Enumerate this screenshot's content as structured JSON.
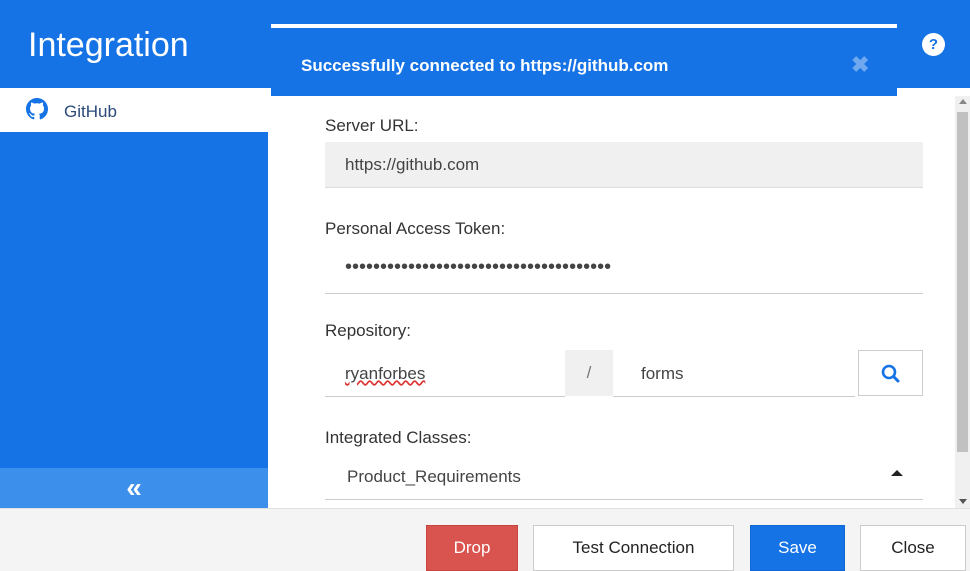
{
  "header": {
    "title": "Integration",
    "help_icon": "help-icon"
  },
  "sidebar": {
    "items": [
      {
        "label": "GitHub",
        "icon": "github-icon"
      }
    ],
    "collapse_label": "«"
  },
  "toast": {
    "message": "Successfully connected to https://github.com",
    "close_label": "✖"
  },
  "form": {
    "server_url": {
      "label": "Server URL:",
      "value": "https://github.com"
    },
    "token": {
      "label": "Personal Access Token:",
      "value": "••••••••••••••••••••••••••••••••••••••"
    },
    "repository": {
      "label": "Repository:",
      "owner": "ryanforbes",
      "separator": "/",
      "name": "forms"
    },
    "classes": {
      "label": "Integrated Classes:",
      "value": "Product_Requirements"
    }
  },
  "footer": {
    "drop_label": "Drop",
    "test_label": "Test Connection",
    "save_label": "Save",
    "close_label": "Close"
  },
  "colors": {
    "primary": "#1573e6",
    "danger": "#d9534f"
  }
}
